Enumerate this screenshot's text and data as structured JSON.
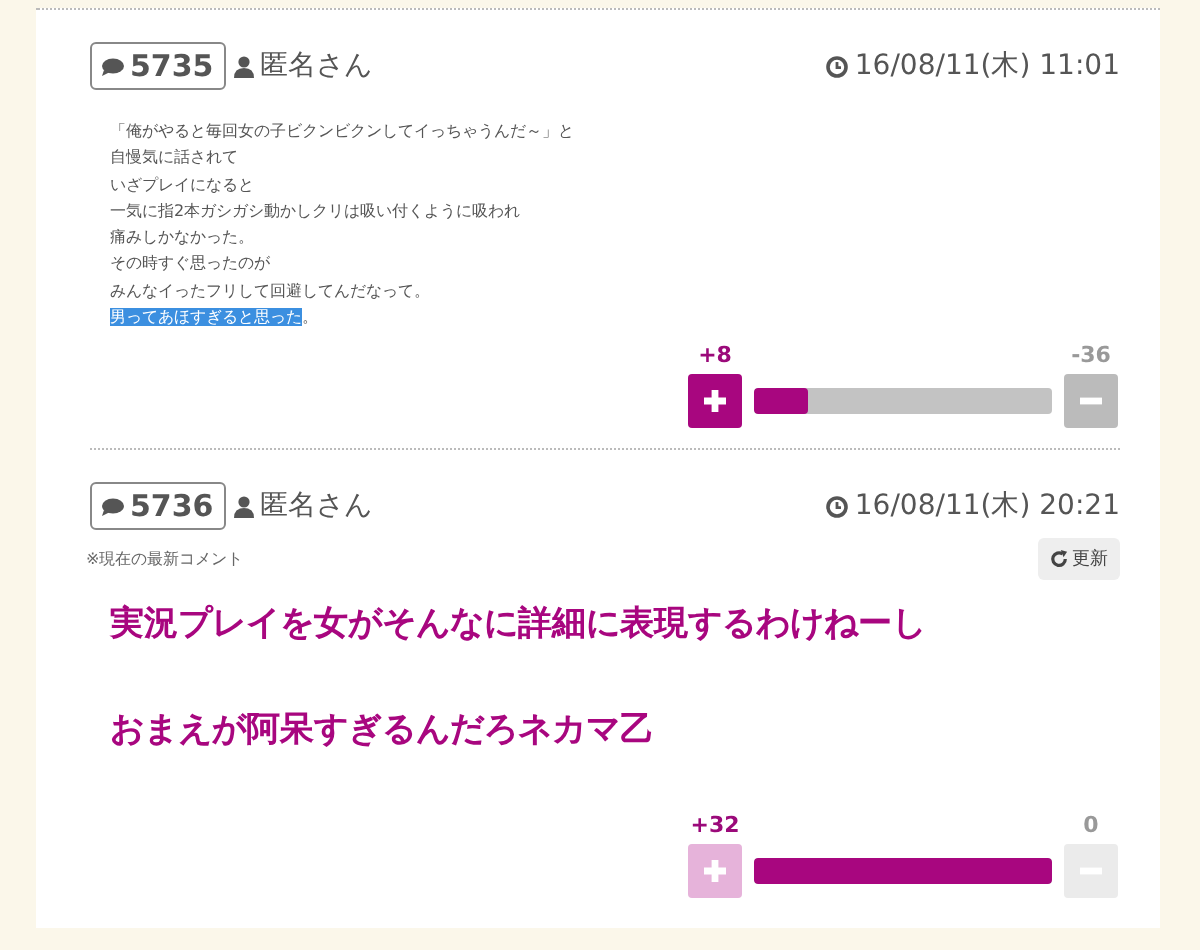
{
  "comments": [
    {
      "number": "5735",
      "author": "匿名さん",
      "time": "16/08/11(木) 11:01",
      "kind": "plain",
      "lines": [
        {
          "text": "「俺がやると毎回女の子ビクンビクンしてイっちゃうんだ～」と",
          "highlighted": false
        },
        {
          "text": "自慢気に話されて",
          "highlighted": false
        },
        {
          "text": "いざプレイになると",
          "highlighted": false
        },
        {
          "text": "一気に指2本ガシガシ動かしクリは吸い付くように吸われ",
          "highlighted": false
        },
        {
          "text": "痛みしかなかった。",
          "highlighted": false
        },
        {
          "text": "その時すぐ思ったのが",
          "highlighted": false
        },
        {
          "text": "みんなイったフリして回避してんだなって。",
          "highlighted": false
        },
        {
          "text": "男ってあほすぎると思った",
          "highlighted": true
        },
        {
          "text": "。",
          "highlighted": false
        }
      ],
      "vote": {
        "plus": "+8",
        "minus": "-36",
        "level": 0.18,
        "disabled": false
      }
    },
    {
      "number": "5736",
      "author": "匿名さん",
      "time": "16/08/11(木) 20:21",
      "note": "※現在の最新コメント",
      "refresh": "更新",
      "kind": "emphasized",
      "lines": [
        {
          "text": "実況プレイを女がそんなに詳細に表現するわけねーし",
          "highlighted": false
        },
        {
          "text": "おまえが阿呆すぎるんだろネカマ乙",
          "highlighted": false
        }
      ],
      "vote": {
        "plus": "+32",
        "minus": "0",
        "level": 1.0,
        "disabled": true
      }
    }
  ]
}
